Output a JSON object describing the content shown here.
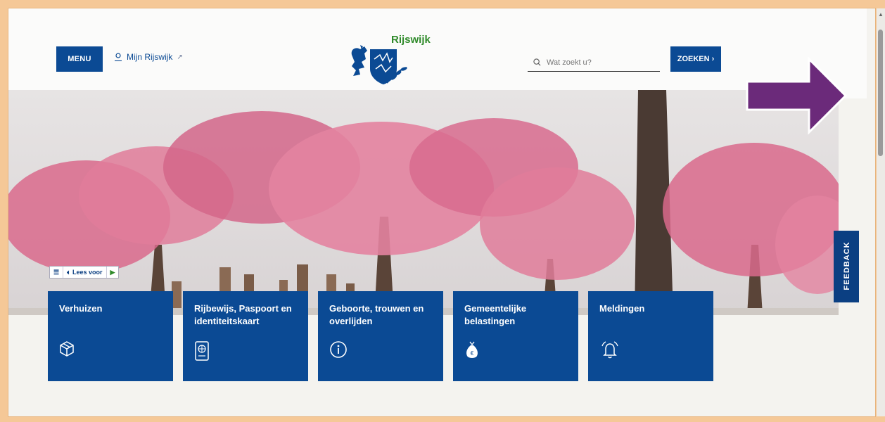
{
  "header": {
    "menu_label": "MENU",
    "mijn_label": "Mijn Rijswijk",
    "logo_title": "Rijswijk",
    "search_placeholder": "Wat zoekt u?",
    "search_button": "ZOEKEN ›"
  },
  "readspeaker": {
    "lees_label": "Lees voor"
  },
  "feedback_label": "FEEDBACK",
  "cards": [
    {
      "title": "Verhuizen",
      "icon": "box-icon"
    },
    {
      "title": "Rijbewijs, Paspoort en identiteitskaart",
      "icon": "passport-icon"
    },
    {
      "title": "Geboorte, trouwen en overlijden",
      "icon": "info-icon"
    },
    {
      "title": "Gemeentelijke belastingen",
      "icon": "money-bag-icon"
    },
    {
      "title": "Meldingen",
      "icon": "bell-icon"
    }
  ],
  "colors": {
    "primary": "#0b4a94",
    "green": "#2f8a2a",
    "arrow": "#6b2a7a",
    "frame": "#f5c897"
  }
}
